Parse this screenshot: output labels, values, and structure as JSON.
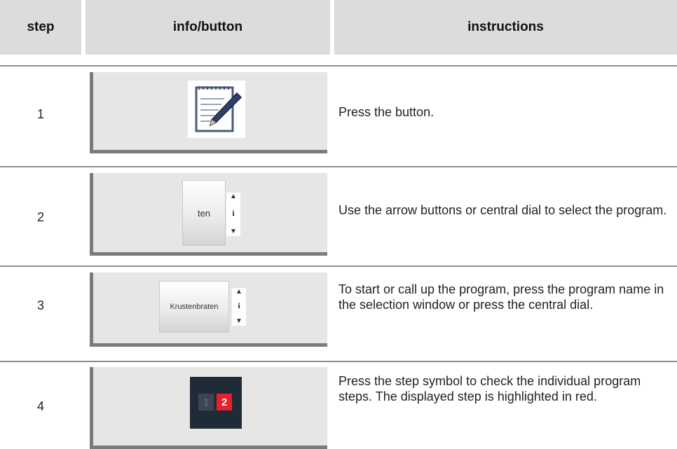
{
  "header": {
    "step": "step",
    "info": "info/button",
    "instructions": "instructions"
  },
  "rows": [
    {
      "step": "1",
      "instruction": "Press the button.",
      "icon": "notepad-icon"
    },
    {
      "step": "2",
      "instruction": "Use the arrow buttons or central dial to select the program.",
      "button_text": "ten",
      "scroll_icons": [
        "arrow-up-icon",
        "info-icon",
        "arrow-down-icon"
      ]
    },
    {
      "step": "3",
      "instruction": "To start or call up the program, press the program name in the selection window or press the central dial.",
      "button_text": "Krustenbraten"
    },
    {
      "step": "4",
      "instruction": "Press the step symbol to check the individual program steps. The displayed step is highlighted in red.",
      "step_symbols": [
        "1",
        "2"
      ],
      "highlight_color": "#e8202a"
    }
  ]
}
